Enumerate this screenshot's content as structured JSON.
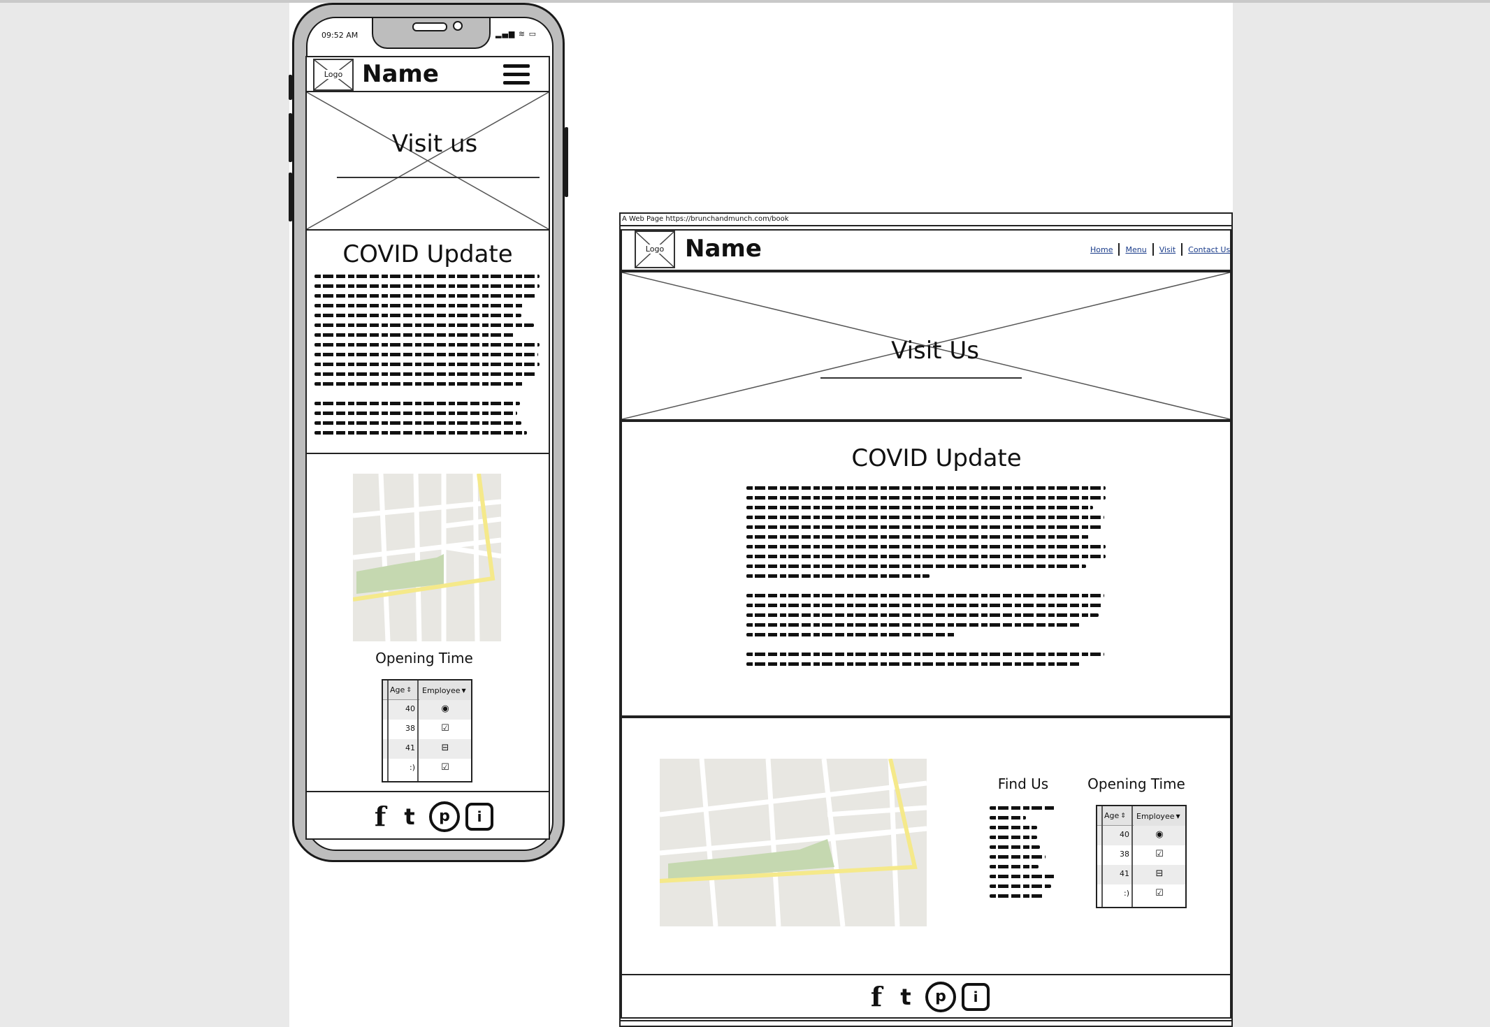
{
  "mobile": {
    "status_time": "09:52 AM",
    "logo_label": "Logo",
    "brand_name": "Name",
    "hero_title": "Visit us",
    "covid_title": "COVID Update",
    "opening_title": "Opening Time",
    "table": {
      "col_age": "Age",
      "col_employee": "Employee",
      "rows": [
        {
          "age": "40",
          "mark": "◉"
        },
        {
          "age": "38",
          "mark": "☑"
        },
        {
          "age": "41",
          "mark": "⊟"
        },
        {
          "age": ":)",
          "mark": "☑"
        }
      ]
    },
    "social": [
      "f",
      "t",
      "p",
      "i"
    ]
  },
  "desktop": {
    "address_bar": "A Web Page https://brunchandmunch.com/book",
    "logo_label": "Logo",
    "brand_name": "Name",
    "nav": [
      "Home",
      "Menu",
      "Visit",
      "Contact Us"
    ],
    "hero_title": "Visit Us",
    "covid_title": "COVID Update",
    "find_us_title": "Find Us",
    "opening_title": "Opening Time",
    "table": {
      "col_age": "Age",
      "col_employee": "Employee",
      "rows": [
        {
          "age": "40",
          "mark": "◉"
        },
        {
          "age": "38",
          "mark": "☑"
        },
        {
          "age": "41",
          "mark": "⊟"
        },
        {
          "age": ":)",
          "mark": "☑"
        }
      ]
    },
    "social": [
      "f",
      "t",
      "p",
      "i"
    ]
  },
  "colors": {
    "map_bg": "#e8e7e2",
    "map_road": "#ffffff",
    "map_park": "#c5d8b0",
    "map_highway": "#f5e98a"
  },
  "icons": [
    "phone-frame",
    "menu-icon",
    "facebook-icon",
    "twitter-icon",
    "pinterest-icon",
    "instagram-icon",
    "radio-icon",
    "checkbox-icon",
    "sort-icon",
    "dropdown-icon"
  ]
}
